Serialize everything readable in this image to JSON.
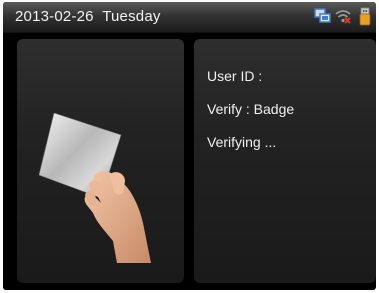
{
  "status_bar": {
    "datetime": "2013-02-26  Tuesday",
    "icons": [
      "network-icon",
      "wifi-off-icon",
      "usb-icon"
    ]
  },
  "verification": {
    "user_id_label": "User ID :",
    "verify_label": "Verify : Badge",
    "status_text": "Verifying ..."
  },
  "illustration": {
    "name": "hand-holding-badge-card"
  },
  "colors": {
    "screen_bg": "#000000",
    "panel_bg": "#242424",
    "text": "#f0f0f0",
    "wifi_off_red": "#e03a20",
    "network_blue": "#3a7fd0"
  }
}
